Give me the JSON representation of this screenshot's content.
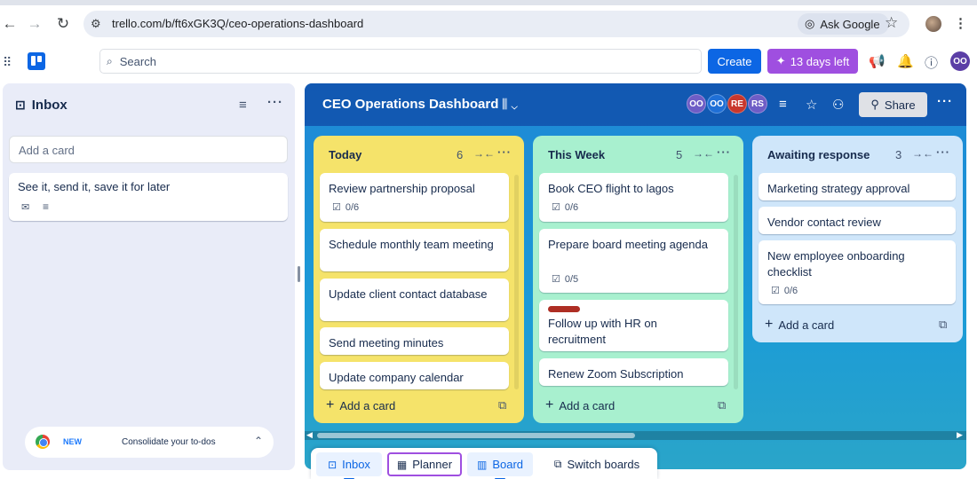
{
  "browser": {
    "url": "trello.com/b/ft6xGK3Q/ceo-operations-dashboard",
    "ask_google_label": "Ask Google"
  },
  "header": {
    "search_placeholder": "Search",
    "create_label": "Create",
    "trial_label": "13 days left",
    "avatar_initials": "OO"
  },
  "inbox": {
    "title": "Inbox",
    "add_card_placeholder": "Add a card",
    "card_text": "See it, send it, save it for later",
    "promo": {
      "new_label": "NEW",
      "message": "Consolidate your to-dos"
    }
  },
  "board": {
    "title": "CEO Operations Dashboard",
    "share_label": "Share",
    "members": [
      {
        "initials": "OO",
        "color": "#6e5dc6"
      },
      {
        "initials": "OO",
        "color": "#1f6fd6"
      },
      {
        "initials": "RE",
        "color": "#c9372c"
      },
      {
        "initials": "RS",
        "color": "#6e5dc6"
      }
    ],
    "lists": [
      {
        "title": "Today",
        "count": "6",
        "color": "#f5e36a",
        "cards": [
          {
            "text": "Review partnership proposal",
            "checklist": "0/6"
          },
          {
            "text": "Schedule monthly team meeting"
          },
          {
            "text": "Update client contact database"
          },
          {
            "text": "Send meeting minutes"
          },
          {
            "text": "Update company calendar"
          }
        ],
        "add_label": "Add a card"
      },
      {
        "title": "This Week",
        "count": "5",
        "color": "#a8f0cf",
        "cards": [
          {
            "text": "Book CEO flight to lagos",
            "checklist": "0/6"
          },
          {
            "text": "Prepare board meeting agenda",
            "checklist": "0/5"
          },
          {
            "text": "Follow up with HR on recruitment",
            "label_color": "#ae2e24"
          },
          {
            "text": "Renew Zoom Subscription"
          }
        ],
        "add_label": "Add a card"
      },
      {
        "title": "Awaiting response",
        "count": "3",
        "color": "#cfe6fa",
        "cards": [
          {
            "text": "Marketing strategy approval"
          },
          {
            "text": "Vendor contact review"
          },
          {
            "text": "New employee onboarding checklist",
            "checklist": "0/6"
          }
        ],
        "add_label": "Add a card"
      }
    ]
  },
  "switcher": {
    "inbox_label": "Inbox",
    "planner_label": "Planner",
    "board_label": "Board",
    "switch_label": "Switch boards"
  }
}
